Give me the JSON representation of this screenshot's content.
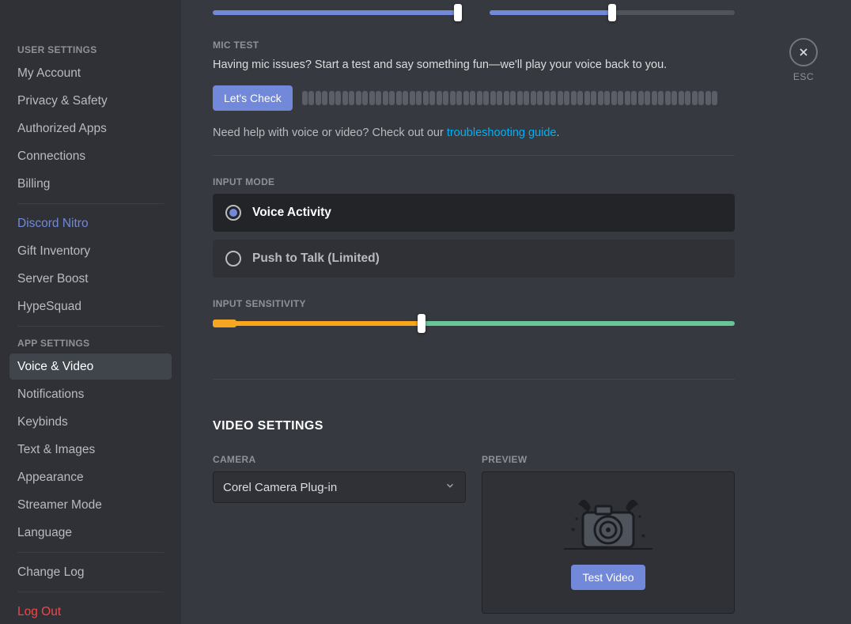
{
  "sidebar": {
    "user_settings_header": "USER SETTINGS",
    "user_items": [
      "My Account",
      "Privacy & Safety",
      "Authorized Apps",
      "Connections",
      "Billing"
    ],
    "nitro_item": "Discord Nitro",
    "nitro_group": [
      "Gift Inventory",
      "Server Boost",
      "HypeSquad"
    ],
    "app_settings_header": "APP SETTINGS",
    "app_items": [
      "Voice & Video",
      "Notifications",
      "Keybinds",
      "Text & Images",
      "Appearance",
      "Streamer Mode",
      "Language"
    ],
    "app_selected_index": 0,
    "change_log": "Change Log",
    "log_out": "Log Out"
  },
  "close": {
    "esc": "ESC"
  },
  "volume_sliders": {
    "left_percent": 100,
    "right_percent": 50
  },
  "mic_test": {
    "header": "MIC TEST",
    "desc": "Having mic issues? Start a test and say something fun—we'll play your voice back to you.",
    "button": "Let's Check"
  },
  "help": {
    "prefix": "Need help with voice or video? Check out our ",
    "link": "troubleshooting guide",
    "suffix": "."
  },
  "input_mode": {
    "header": "INPUT MODE",
    "options": [
      "Voice Activity",
      "Push to Talk (Limited)"
    ],
    "selected_index": 0
  },
  "input_sensitivity": {
    "header": "INPUT SENSITIVITY",
    "threshold_percent": 40
  },
  "video": {
    "title": "VIDEO SETTINGS",
    "camera_label": "CAMERA",
    "camera_value": "Corel Camera Plug-in",
    "preview_label": "PREVIEW",
    "test_button": "Test Video"
  }
}
